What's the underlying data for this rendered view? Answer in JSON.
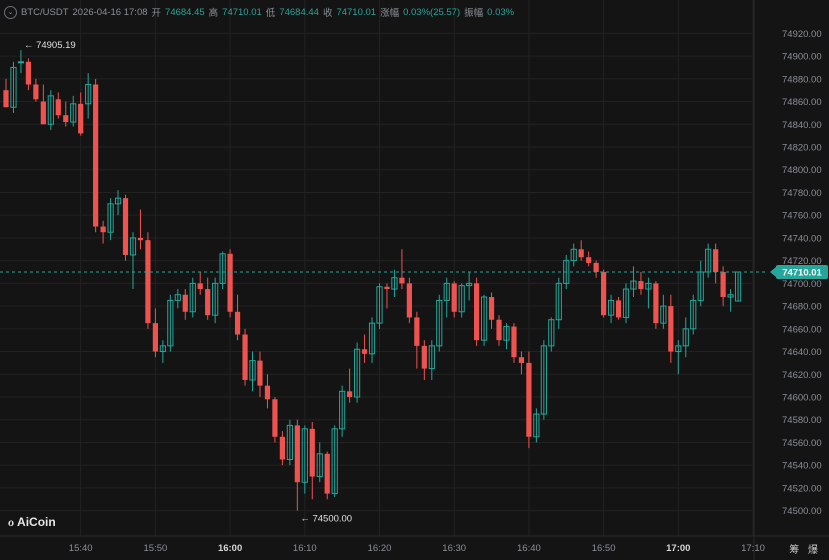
{
  "header": {
    "symbol": "BTC/USDT",
    "datetime": "2026-04-16 17:08",
    "open_label": "开",
    "open": "74684.45",
    "high_label": "高",
    "high": "74710.01",
    "low_label": "低",
    "low": "74684.44",
    "close_label": "收",
    "close": "74710.01",
    "change_label": "涨幅",
    "change": "0.03%(25.57)",
    "amplitude_label": "振幅",
    "amplitude": "0.03%"
  },
  "logo": {
    "text": "AiCoin",
    "icon": "aicoin-logo-icon"
  },
  "corner_text": "筹 爆",
  "colors": {
    "background": "#141414",
    "up": "#26a69a",
    "down": "#ef5350",
    "current_price": "#26a69a",
    "grid": "#222222"
  },
  "chart_data": {
    "type": "candlestick",
    "interval_minutes": 1,
    "ylim": [
      74490,
      74930
    ],
    "y_ticks": [
      "74920.00",
      "74900.00",
      "74880.00",
      "74860.00",
      "74840.00",
      "74820.00",
      "74800.00",
      "74780.00",
      "74760.00",
      "74740.00",
      "74720.00",
      "74700.00",
      "74680.00",
      "74660.00",
      "74640.00",
      "74620.00",
      "74600.00",
      "74580.00",
      "74560.00",
      "74540.00",
      "74520.00",
      "74500.00"
    ],
    "x_ticks": [
      {
        "label": "15:40",
        "index": 10,
        "bold": false
      },
      {
        "label": "15:50",
        "index": 20,
        "bold": false
      },
      {
        "label": "16:00",
        "index": 30,
        "bold": true
      },
      {
        "label": "16:10",
        "index": 40,
        "bold": false
      },
      {
        "label": "16:20",
        "index": 50,
        "bold": false
      },
      {
        "label": "16:30",
        "index": 60,
        "bold": false
      },
      {
        "label": "16:40",
        "index": 70,
        "bold": false
      },
      {
        "label": "16:50",
        "index": 80,
        "bold": false
      },
      {
        "label": "17:00",
        "index": 90,
        "bold": true
      },
      {
        "label": "17:10",
        "index": 100,
        "bold": false
      }
    ],
    "current_price": "74710.01",
    "high_marker": {
      "label": "← 74905.19",
      "index": 2,
      "value": 74905.19
    },
    "low_marker": {
      "label": "← 74500.00",
      "index": 39,
      "value": 74500.0
    },
    "candles": [
      [
        74870,
        74880,
        74855,
        74855
      ],
      [
        74855,
        74895,
        74850,
        74890
      ],
      [
        74895,
        74905.19,
        74885,
        74895
      ],
      [
        74895,
        74898,
        74870,
        74875
      ],
      [
        74875,
        74880,
        74860,
        74862
      ],
      [
        74860,
        74875,
        74840,
        74840
      ],
      [
        74840,
        74870,
        74835,
        74865
      ],
      [
        74862,
        74868,
        74845,
        74848
      ],
      [
        74848,
        74860,
        74838,
        74842
      ],
      [
        74842,
        74865,
        74838,
        74858
      ],
      [
        74858,
        74868,
        74830,
        74832
      ],
      [
        74858,
        74885,
        74845,
        74875
      ],
      [
        74875,
        74880,
        74745,
        74750
      ],
      [
        74750,
        74755,
        74735,
        74745
      ],
      [
        74745,
        74775,
        74738,
        74770
      ],
      [
        74770,
        74782,
        74760,
        74775
      ],
      [
        74775,
        74778,
        74720,
        74725
      ],
      [
        74725,
        74745,
        74695,
        74740
      ],
      [
        74740,
        74765,
        74730,
        74738
      ],
      [
        74738,
        74745,
        74660,
        74665
      ],
      [
        74665,
        74678,
        74635,
        74640
      ],
      [
        74640,
        74650,
        74630,
        74645
      ],
      [
        74645,
        74690,
        74640,
        74685
      ],
      [
        74685,
        74695,
        74678,
        74690
      ],
      [
        74690,
        74695,
        74668,
        74675
      ],
      [
        74675,
        74705,
        74670,
        74700
      ],
      [
        74700,
        74710,
        74690,
        74695
      ],
      [
        74695,
        74705,
        74668,
        74672
      ],
      [
        74672,
        74705,
        74665,
        74700
      ],
      [
        74700,
        74728,
        74695,
        74726
      ],
      [
        74726,
        74730,
        74670,
        74675
      ],
      [
        74675,
        74690,
        74650,
        74655
      ],
      [
        74655,
        74660,
        74610,
        74615
      ],
      [
        74615,
        74640,
        74605,
        74632
      ],
      [
        74632,
        74640,
        74600,
        74610
      ],
      [
        74610,
        74620,
        74590,
        74598
      ],
      [
        74598,
        74600,
        74560,
        74565
      ],
      [
        74565,
        74570,
        74540,
        74545
      ],
      [
        74545,
        74580,
        74540,
        74575
      ],
      [
        74575,
        74580,
        74500,
        74525
      ],
      [
        74525,
        74575,
        74515,
        74572
      ],
      [
        74572,
        74578,
        74510,
        74530
      ],
      [
        74530,
        74560,
        74525,
        74550
      ],
      [
        74550,
        74552,
        74510,
        74515
      ],
      [
        74515,
        74575,
        74512,
        74572
      ],
      [
        74572,
        74610,
        74565,
        74605
      ],
      [
        74605,
        74625,
        74595,
        74600
      ],
      [
        74600,
        74648,
        74595,
        74642
      ],
      [
        74642,
        74655,
        74630,
        74638
      ],
      [
        74638,
        74670,
        74630,
        74665
      ],
      [
        74665,
        74700,
        74660,
        74697
      ],
      [
        74697,
        74700,
        74678,
        74695
      ],
      [
        74695,
        74712,
        74688,
        74705
      ],
      [
        74705,
        74730,
        74695,
        74700
      ],
      [
        74700,
        74705,
        74665,
        74670
      ],
      [
        74670,
        74675,
        74625,
        74645
      ],
      [
        74645,
        74650,
        74615,
        74625
      ],
      [
        74625,
        74650,
        74615,
        74645
      ],
      [
        74645,
        74690,
        74640,
        74685
      ],
      [
        74685,
        74705,
        74670,
        74700
      ],
      [
        74700,
        74702,
        74670,
        74675
      ],
      [
        74675,
        74700,
        74670,
        74698
      ],
      [
        74698,
        74710,
        74685,
        74700
      ],
      [
        74700,
        74705,
        74645,
        74650
      ],
      [
        74650,
        74690,
        74645,
        74688
      ],
      [
        74688,
        74692,
        74660,
        74668
      ],
      [
        74668,
        74672,
        74645,
        74650
      ],
      [
        74650,
        74665,
        74642,
        74662
      ],
      [
        74662,
        74665,
        74630,
        74635
      ],
      [
        74635,
        74640,
        74620,
        74630
      ],
      [
        74630,
        74640,
        74555,
        74565
      ],
      [
        74565,
        74590,
        74560,
        74585
      ],
      [
        74585,
        74650,
        74580,
        74645
      ],
      [
        74645,
        74670,
        74640,
        74668
      ],
      [
        74668,
        74705,
        74660,
        74700
      ],
      [
        74700,
        74725,
        74695,
        74720
      ],
      [
        74720,
        74735,
        74715,
        74730
      ],
      [
        74730,
        74738,
        74720,
        74723
      ],
      [
        74723,
        74728,
        74715,
        74718
      ],
      [
        74718,
        74720,
        74705,
        74710
      ],
      [
        74710,
        74712,
        74670,
        74672
      ],
      [
        74672,
        74690,
        74665,
        74685
      ],
      [
        74685,
        74688,
        74668,
        74670
      ],
      [
        74670,
        74700,
        74665,
        74695
      ],
      [
        74695,
        74715,
        74688,
        74702
      ],
      [
        74702,
        74710,
        74690,
        74695
      ],
      [
        74695,
        74705,
        74678,
        74700
      ],
      [
        74700,
        74702,
        74660,
        74665
      ],
      [
        74665,
        74690,
        74660,
        74680
      ],
      [
        74680,
        74690,
        74630,
        74640
      ],
      [
        74640,
        74650,
        74620,
        74645
      ],
      [
        74645,
        74670,
        74635,
        74660
      ],
      [
        74660,
        74690,
        74655,
        74685
      ],
      [
        74685,
        74720,
        74680,
        74710
      ],
      [
        74710,
        74735,
        74705,
        74730
      ],
      [
        74730,
        74735,
        74700,
        74710
      ],
      [
        74710,
        74715,
        74680,
        74688
      ],
      [
        74688,
        74695,
        74675,
        74690
      ],
      [
        74684.45,
        74710.01,
        74684.44,
        74710.01
      ]
    ]
  }
}
